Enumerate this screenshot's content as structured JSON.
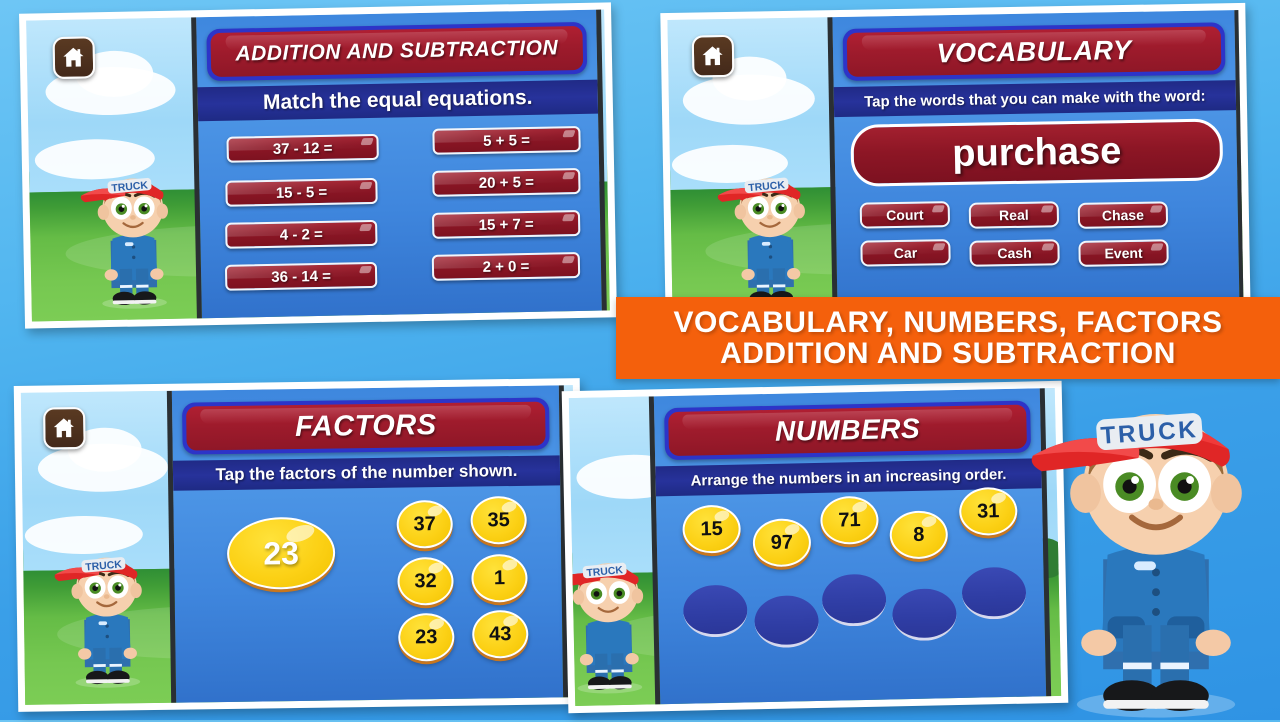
{
  "banner": {
    "line1": "VOCABULARY, NUMBERS, FACTORS",
    "line2": "ADDITION AND SUBTRACTION",
    "color": "#f4600c"
  },
  "mascot": {
    "cap_text": "TRUCK"
  },
  "icons": {
    "home": "home-icon"
  },
  "colors": {
    "title_red": "#9e1b2c",
    "title_border_blue": "#2d34c8",
    "panel_blue": "#3f86dd",
    "instruction_navy": "#27329b",
    "coin_yellow": "#fcd116",
    "slot_blue": "#2f3da4"
  },
  "cards": [
    {
      "id": "addition-subtraction",
      "title": "ADDITION AND SUBTRACTION",
      "instruction": "Match the equal equations.",
      "left_column": [
        "37 - 12 =",
        "15 - 5 =",
        "4 - 2 =",
        "36 - 14 ="
      ],
      "right_column": [
        "5 + 5 =",
        "20 + 5 =",
        "15 + 7 =",
        "2 + 0 ="
      ]
    },
    {
      "id": "vocabulary",
      "title": "VOCABULARY",
      "instruction": "Tap the words that you can make with the word:",
      "word": "purchase",
      "options": [
        "Court",
        "Real",
        "Chase",
        "Car",
        "Cash",
        "Event"
      ]
    },
    {
      "id": "factors",
      "title": "FACTORS",
      "instruction": "Tap the factors of the number shown.",
      "target_number": "23",
      "choices": [
        "37",
        "35",
        "32",
        "1",
        "23",
        "43"
      ]
    },
    {
      "id": "numbers",
      "title": "NUMBERS",
      "instruction": "Arrange the numbers in an increasing order.",
      "numbers": [
        "15",
        "97",
        "71",
        "8",
        "31"
      ],
      "slot_count": 5
    }
  ]
}
